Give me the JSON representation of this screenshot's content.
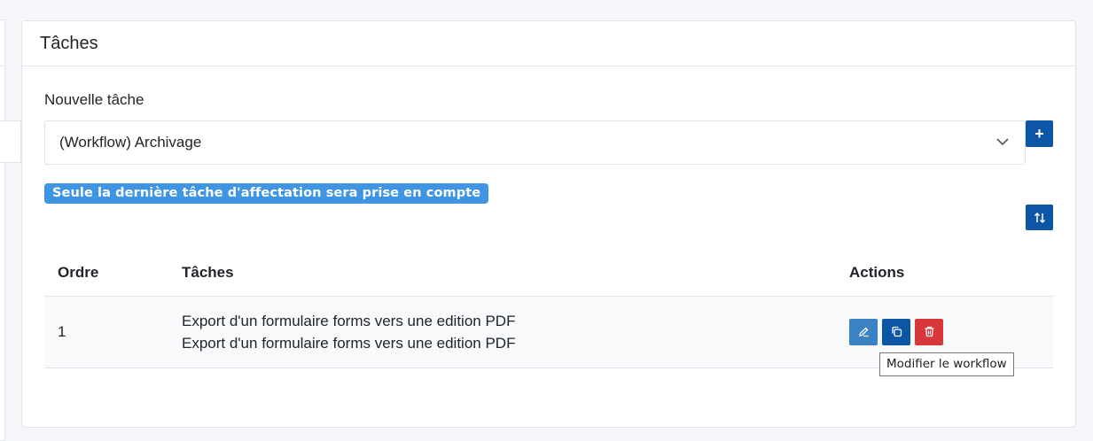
{
  "card": {
    "title": "Tâches"
  },
  "new_task": {
    "label": "Nouvelle tâche",
    "selected": "(Workflow) Archivage",
    "add_label": "+"
  },
  "notice": "Seule la dernière tâche d'affectation sera prise en compte",
  "table": {
    "headers": {
      "order": "Ordre",
      "tasks": "Tâches",
      "actions": "Actions"
    },
    "rows": [
      {
        "order": "1",
        "line1": "Export d'un formulaire forms vers une edition PDF",
        "line2": "Export d'un formulaire forms vers une edition PDF"
      }
    ]
  },
  "tooltip": "Modifier le workflow",
  "colors": {
    "primary": "#0d56a6",
    "info": "#3f95e3",
    "danger": "#d9383a",
    "edit": "#3b82c4"
  }
}
